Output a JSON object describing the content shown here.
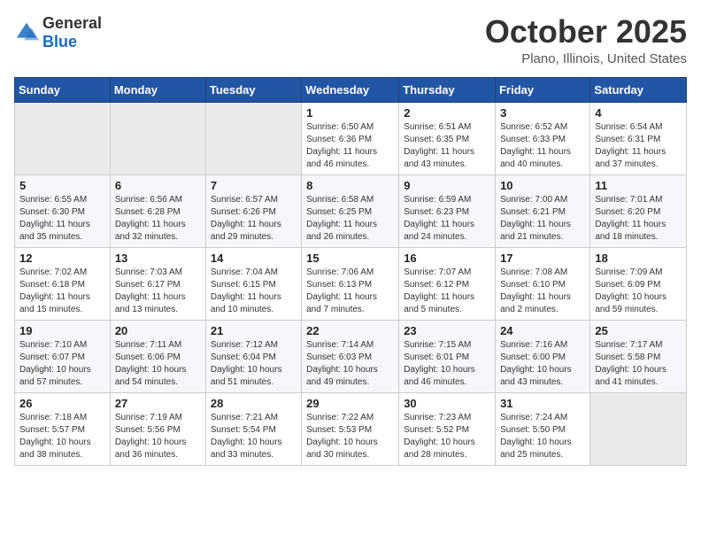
{
  "header": {
    "logo": {
      "general": "General",
      "blue": "Blue"
    },
    "month": "October 2025",
    "location": "Plano, Illinois, United States"
  },
  "weekdays": [
    "Sunday",
    "Monday",
    "Tuesday",
    "Wednesday",
    "Thursday",
    "Friday",
    "Saturday"
  ],
  "weeks": [
    [
      {
        "day": "",
        "info": ""
      },
      {
        "day": "",
        "info": ""
      },
      {
        "day": "",
        "info": ""
      },
      {
        "day": "1",
        "info": "Sunrise: 6:50 AM\nSunset: 6:36 PM\nDaylight: 11 hours\nand 46 minutes."
      },
      {
        "day": "2",
        "info": "Sunrise: 6:51 AM\nSunset: 6:35 PM\nDaylight: 11 hours\nand 43 minutes."
      },
      {
        "day": "3",
        "info": "Sunrise: 6:52 AM\nSunset: 6:33 PM\nDaylight: 11 hours\nand 40 minutes."
      },
      {
        "day": "4",
        "info": "Sunrise: 6:54 AM\nSunset: 6:31 PM\nDaylight: 11 hours\nand 37 minutes."
      }
    ],
    [
      {
        "day": "5",
        "info": "Sunrise: 6:55 AM\nSunset: 6:30 PM\nDaylight: 11 hours\nand 35 minutes."
      },
      {
        "day": "6",
        "info": "Sunrise: 6:56 AM\nSunset: 6:28 PM\nDaylight: 11 hours\nand 32 minutes."
      },
      {
        "day": "7",
        "info": "Sunrise: 6:57 AM\nSunset: 6:26 PM\nDaylight: 11 hours\nand 29 minutes."
      },
      {
        "day": "8",
        "info": "Sunrise: 6:58 AM\nSunset: 6:25 PM\nDaylight: 11 hours\nand 26 minutes."
      },
      {
        "day": "9",
        "info": "Sunrise: 6:59 AM\nSunset: 6:23 PM\nDaylight: 11 hours\nand 24 minutes."
      },
      {
        "day": "10",
        "info": "Sunrise: 7:00 AM\nSunset: 6:21 PM\nDaylight: 11 hours\nand 21 minutes."
      },
      {
        "day": "11",
        "info": "Sunrise: 7:01 AM\nSunset: 6:20 PM\nDaylight: 11 hours\nand 18 minutes."
      }
    ],
    [
      {
        "day": "12",
        "info": "Sunrise: 7:02 AM\nSunset: 6:18 PM\nDaylight: 11 hours\nand 15 minutes."
      },
      {
        "day": "13",
        "info": "Sunrise: 7:03 AM\nSunset: 6:17 PM\nDaylight: 11 hours\nand 13 minutes."
      },
      {
        "day": "14",
        "info": "Sunrise: 7:04 AM\nSunset: 6:15 PM\nDaylight: 11 hours\nand 10 minutes."
      },
      {
        "day": "15",
        "info": "Sunrise: 7:06 AM\nSunset: 6:13 PM\nDaylight: 11 hours\nand 7 minutes."
      },
      {
        "day": "16",
        "info": "Sunrise: 7:07 AM\nSunset: 6:12 PM\nDaylight: 11 hours\nand 5 minutes."
      },
      {
        "day": "17",
        "info": "Sunrise: 7:08 AM\nSunset: 6:10 PM\nDaylight: 11 hours\nand 2 minutes."
      },
      {
        "day": "18",
        "info": "Sunrise: 7:09 AM\nSunset: 6:09 PM\nDaylight: 10 hours\nand 59 minutes."
      }
    ],
    [
      {
        "day": "19",
        "info": "Sunrise: 7:10 AM\nSunset: 6:07 PM\nDaylight: 10 hours\nand 57 minutes."
      },
      {
        "day": "20",
        "info": "Sunrise: 7:11 AM\nSunset: 6:06 PM\nDaylight: 10 hours\nand 54 minutes."
      },
      {
        "day": "21",
        "info": "Sunrise: 7:12 AM\nSunset: 6:04 PM\nDaylight: 10 hours\nand 51 minutes."
      },
      {
        "day": "22",
        "info": "Sunrise: 7:14 AM\nSunset: 6:03 PM\nDaylight: 10 hours\nand 49 minutes."
      },
      {
        "day": "23",
        "info": "Sunrise: 7:15 AM\nSunset: 6:01 PM\nDaylight: 10 hours\nand 46 minutes."
      },
      {
        "day": "24",
        "info": "Sunrise: 7:16 AM\nSunset: 6:00 PM\nDaylight: 10 hours\nand 43 minutes."
      },
      {
        "day": "25",
        "info": "Sunrise: 7:17 AM\nSunset: 5:58 PM\nDaylight: 10 hours\nand 41 minutes."
      }
    ],
    [
      {
        "day": "26",
        "info": "Sunrise: 7:18 AM\nSunset: 5:57 PM\nDaylight: 10 hours\nand 38 minutes."
      },
      {
        "day": "27",
        "info": "Sunrise: 7:19 AM\nSunset: 5:56 PM\nDaylight: 10 hours\nand 36 minutes."
      },
      {
        "day": "28",
        "info": "Sunrise: 7:21 AM\nSunset: 5:54 PM\nDaylight: 10 hours\nand 33 minutes."
      },
      {
        "day": "29",
        "info": "Sunrise: 7:22 AM\nSunset: 5:53 PM\nDaylight: 10 hours\nand 30 minutes."
      },
      {
        "day": "30",
        "info": "Sunrise: 7:23 AM\nSunset: 5:52 PM\nDaylight: 10 hours\nand 28 minutes."
      },
      {
        "day": "31",
        "info": "Sunrise: 7:24 AM\nSunset: 5:50 PM\nDaylight: 10 hours\nand 25 minutes."
      },
      {
        "day": "",
        "info": ""
      }
    ]
  ]
}
